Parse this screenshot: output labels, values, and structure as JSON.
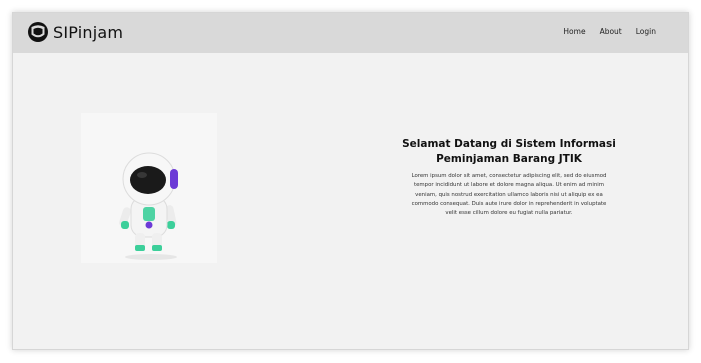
{
  "navbar": {
    "brand": "SIPinjam",
    "brand_icon": "logo-icon",
    "links": [
      {
        "label": "Home"
      },
      {
        "label": "About"
      },
      {
        "label": "Login"
      }
    ]
  },
  "hero": {
    "image_icon": "astronaut-robot-illustration",
    "title": "Selamat Datang di Sistem Informasi Peminjaman Barang JTIK",
    "body": "Lorem ipsum dolor sit amet, consectetur adipiscing elit, sed do eiusmod tempor incididunt ut labore et dolore magna aliqua. Ut enim ad minim veniam, quis nostrud exercitation ullamco laboris nisi ut aliquip ex ea commodo consequat. Duis aute irure dolor in reprehenderit in voluptate velit esse cillum dolore eu fugiat nulla pariatur."
  },
  "colors": {
    "navbar_bg": "#d9d9d9",
    "page_bg": "#f2f2f2",
    "accent_purple": "#6c3ad6",
    "accent_green": "#3ccf9a"
  }
}
